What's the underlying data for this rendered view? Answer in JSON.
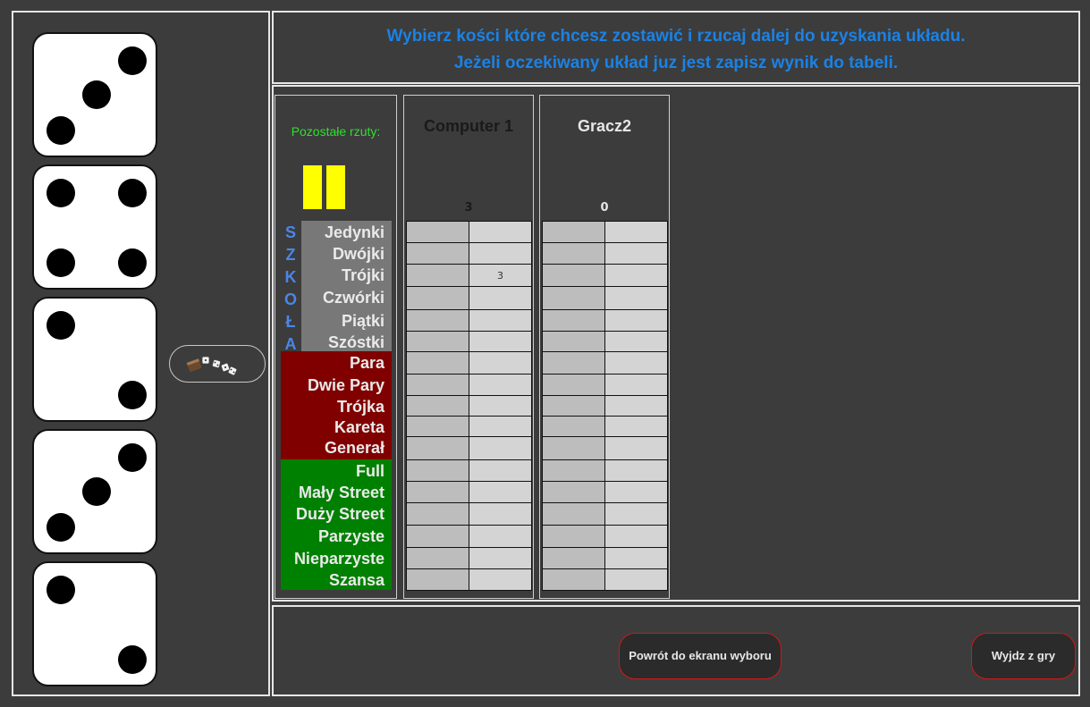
{
  "instructions": {
    "line1": "Wybierz kości które chcesz zostawić i rzucaj dalej do uzyskania układu.",
    "line2": "Jeżeli oczekiwany układ juz jest zapisz wynik do tabeli."
  },
  "dice": [
    3,
    4,
    2,
    3,
    2
  ],
  "remaining_rolls": {
    "label": "Pozostałe rzuty:",
    "count": 2,
    "bar_color": "#ffff00"
  },
  "roll_button": {
    "icon": "dice-cup-icon"
  },
  "school_letters": [
    "S",
    "Z",
    "K",
    "O",
    "Ł",
    "A"
  ],
  "sections": {
    "school": {
      "color": "#787878",
      "rows": [
        "Jedynki",
        "Dwójki",
        "Trójki",
        "Czwórki",
        "Piątki",
        "Szóstki"
      ]
    },
    "combos": {
      "color": "#800000",
      "rows": [
        "Para",
        "Dwie Pary",
        "Trójka",
        "Kareta",
        "Generał"
      ]
    },
    "special": {
      "color": "#008000",
      "rows": [
        "Full",
        "Mały Street",
        "Duży Street",
        "Parzyste",
        "Nieparzyste",
        "Szansa"
      ]
    }
  },
  "players": [
    {
      "name": "Computer 1",
      "name_color": "#1a1a1a",
      "total": "3",
      "total_color": "#1a1a1a",
      "scores": [
        [
          "",
          ""
        ],
        [
          "",
          ""
        ],
        [
          "",
          "3"
        ],
        [
          "",
          ""
        ],
        [
          "",
          ""
        ],
        [
          "",
          ""
        ],
        [
          "",
          ""
        ],
        [
          "",
          ""
        ],
        [
          "",
          ""
        ],
        [
          "",
          ""
        ],
        [
          "",
          ""
        ],
        [
          "",
          ""
        ],
        [
          "",
          ""
        ],
        [
          "",
          ""
        ],
        [
          "",
          ""
        ],
        [
          "",
          ""
        ],
        [
          "",
          ""
        ]
      ]
    },
    {
      "name": "Gracz2",
      "name_color": "#e6e6e6",
      "total": "0",
      "total_color": "#e6e6e6",
      "scores": [
        [
          "",
          ""
        ],
        [
          "",
          ""
        ],
        [
          "",
          ""
        ],
        [
          "",
          ""
        ],
        [
          "",
          ""
        ],
        [
          "",
          ""
        ],
        [
          "",
          ""
        ],
        [
          "",
          ""
        ],
        [
          "",
          ""
        ],
        [
          "",
          ""
        ],
        [
          "",
          ""
        ],
        [
          "",
          ""
        ],
        [
          "",
          ""
        ],
        [
          "",
          ""
        ],
        [
          "",
          ""
        ],
        [
          "",
          ""
        ],
        [
          "",
          ""
        ]
      ]
    }
  ],
  "cell_colors": {
    "dark": "#bdbdbd",
    "light": "#d4d4d4"
  },
  "buttons": {
    "back": "Powrót do ekranu wyboru",
    "exit": "Wyjdz z gry"
  }
}
